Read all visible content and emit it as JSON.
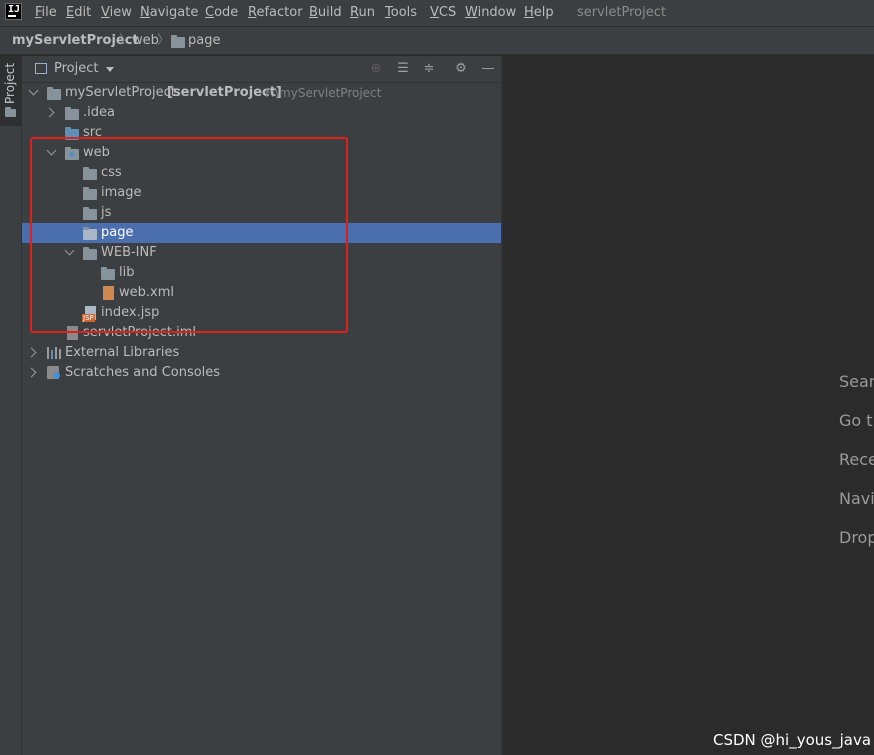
{
  "menu": {
    "items": [
      "File",
      "Edit",
      "View",
      "Navigate",
      "Code",
      "Refactor",
      "Build",
      "Run",
      "Tools",
      "VCS",
      "Window",
      "Help"
    ],
    "project_title": "servletProject"
  },
  "breadcrumb": [
    "myServletProject",
    "web",
    "page"
  ],
  "tool_stripe": {
    "project_label": "Project"
  },
  "panel": {
    "title": "Project"
  },
  "tree": {
    "root": {
      "name": "myServletProject",
      "module": "[servletProject]",
      "path": "F:\\myServletProject"
    },
    "idea": ".idea",
    "src": "src",
    "web": "web",
    "css": "css",
    "image": "image",
    "js": "js",
    "page": "page",
    "webinf": "WEB-INF",
    "lib": "lib",
    "webxml": "web.xml",
    "indexjsp": "index.jsp",
    "iml": "servletProject.iml",
    "external": "External Libraries",
    "scratches": "Scratches and Consoles"
  },
  "editor_hints": [
    "Sear",
    "Go t",
    "Rece",
    "Navi",
    "Drop"
  ],
  "watermark": "CSDN @hi_yous_java",
  "colors": {
    "selection": "#4b6eaf",
    "highlight_box": "#e0201a",
    "panel_bg": "#3c3f41",
    "editor_bg": "#2b2b2b"
  }
}
